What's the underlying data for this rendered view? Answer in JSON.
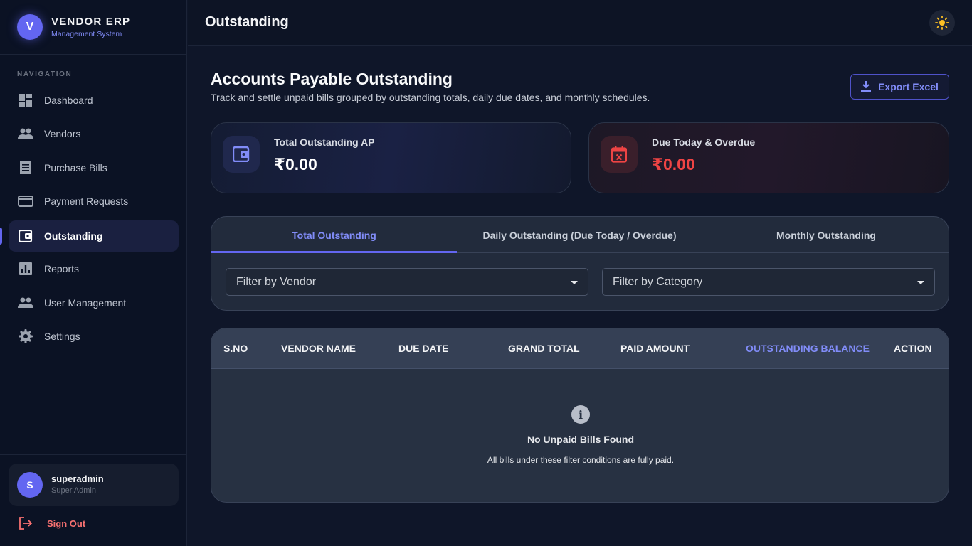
{
  "brand": {
    "logo_letter": "V",
    "title": "VENDOR ERP",
    "subtitle": "Management System"
  },
  "sidebar": {
    "heading": "NAVIGATION",
    "items": [
      {
        "label": "Dashboard",
        "icon": "dashboard-icon"
      },
      {
        "label": "Vendors",
        "icon": "people-icon"
      },
      {
        "label": "Purchase Bills",
        "icon": "receipt-icon"
      },
      {
        "label": "Payment Requests",
        "icon": "credit-card-icon"
      },
      {
        "label": "Outstanding",
        "icon": "wallet-icon",
        "active": true
      },
      {
        "label": "Reports",
        "icon": "bar-chart-icon"
      },
      {
        "label": "User Management",
        "icon": "people-icon"
      },
      {
        "label": "Settings",
        "icon": "gear-icon"
      }
    ],
    "user": {
      "initial": "S",
      "name": "superadmin",
      "role": "Super Admin"
    },
    "signout_label": "Sign Out"
  },
  "topbar": {
    "title": "Outstanding",
    "theme_icon": "sun-icon"
  },
  "page": {
    "title": "Accounts Payable Outstanding",
    "subtitle": "Track and settle unpaid bills grouped by outstanding totals, daily due dates, and monthly schedules.",
    "export_label": "Export Excel"
  },
  "stats": [
    {
      "label": "Total Outstanding AP",
      "value": "₹0.00",
      "icon": "wallet-icon",
      "color": "#818cf8"
    },
    {
      "label": "Due Today & Overdue",
      "value": "₹0.00",
      "icon": "calendar-x-icon",
      "color": "#ef4444"
    }
  ],
  "tabs": [
    {
      "label": "Total Outstanding",
      "active": true
    },
    {
      "label": "Daily Outstanding (Due Today / Overdue)"
    },
    {
      "label": "Monthly Outstanding"
    }
  ],
  "filters": {
    "vendor": {
      "value": "Filter by Vendor"
    },
    "category": {
      "value": "Filter by Category"
    }
  },
  "table": {
    "columns": [
      "S.NO",
      "VENDOR NAME",
      "DUE DATE",
      "GRAND TOTAL",
      "PAID AMOUNT",
      "OUTSTANDING BALANCE",
      "ACTION"
    ],
    "highlight_color": "#818cf8",
    "rows": [],
    "empty": {
      "icon": "info-icon",
      "icon_glyph": "i",
      "title": "No Unpaid Bills Found",
      "message": "All bills under these filter conditions are fully paid."
    }
  }
}
